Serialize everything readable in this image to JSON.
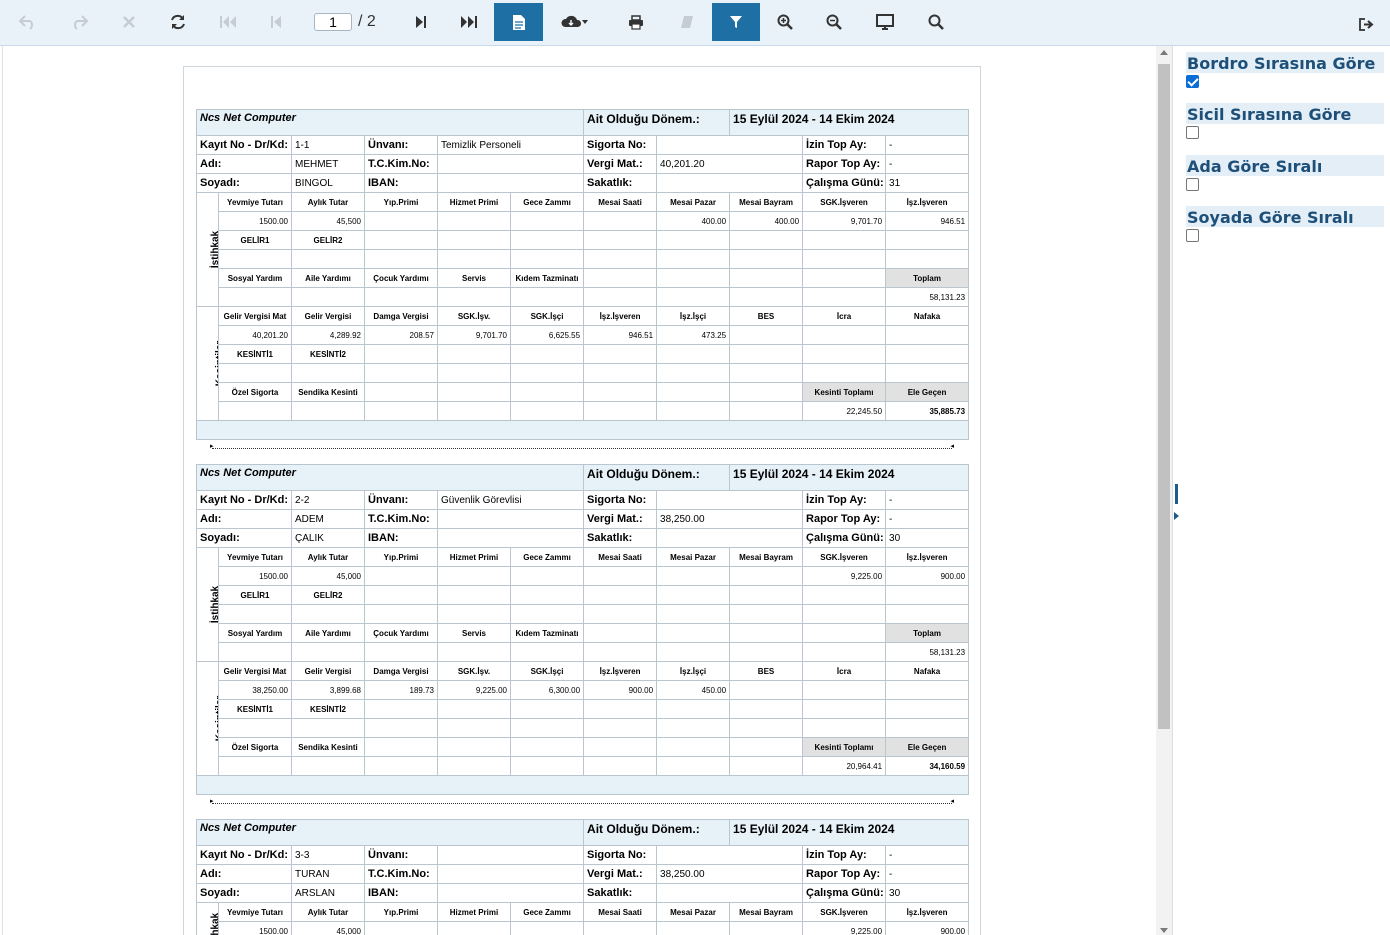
{
  "toolbar": {
    "page_current": "1",
    "page_total": "/ 2",
    "buttons": [
      "undo-icon",
      "redo-icon",
      "close-icon",
      "refresh-icon",
      "first-page-icon",
      "previous-page-icon",
      "next-page-icon",
      "last-page-icon",
      "document-icon",
      "download-icon",
      "print-icon",
      "edit-icon",
      "filter-icon",
      "zoom-in-icon",
      "zoom-out-icon",
      "fullscreen-icon",
      "search-icon",
      "exit-icon"
    ]
  },
  "sidebar": {
    "options": [
      {
        "label": "Bordro Sırasına Göre",
        "checked": true
      },
      {
        "label": "Sicil Sırasına Göre",
        "checked": false
      },
      {
        "label": "Ada Göre Sıralı",
        "checked": false
      },
      {
        "label": "Soyada Göre Sıralı",
        "checked": false
      }
    ]
  },
  "labels": {
    "company": "Ncs Net Computer",
    "period_label": "Ait Olduğu Dönem.:",
    "period": "15 Eylül 2024 - 14 Ekim 2024",
    "kayit": "Kayıt No - Dr/Kd:",
    "unvan": "Ünvanı:",
    "sigorta": "Sigorta No:",
    "izin": "İzin Top Ay:",
    "adi": "Adı:",
    "tc": "T.C.Kim.No:",
    "vergi": "Vergi Mat.:",
    "rapor": "Rapor Top Ay:",
    "soyadi": "Soyadı:",
    "iban": "IBAN:",
    "sakatlik": "Sakatlık:",
    "calisma": "Çalışma Günü:",
    "istihkak": "İstihkak",
    "kesintiler": "Kesintiler",
    "row1": [
      "Yevmiye Tutarı",
      "Aylık Tutar",
      "Yıp.Primi",
      "Hizmet Primi",
      "Gece Zammı",
      "Mesai Saati",
      "Mesai Pazar",
      "Mesai Bayram",
      "SGK.İşveren",
      "İşz.İşveren"
    ],
    "row2": [
      "GELİR1",
      "GELİR2"
    ],
    "row3": [
      "Sosyal Yardım",
      "Aile Yardımı",
      "Çocuk Yardımı",
      "Servis",
      "Kıdem Tazminatı",
      "Toplam"
    ],
    "row4": [
      "Gelir Vergisi Mat",
      "Gelir Vergisi",
      "Damga Vergisi",
      "SGK.İşv.",
      "SGK.İşçi",
      "İşz.İşveren",
      "İşz.İşçi",
      "BES",
      "İcra",
      "Nafaka"
    ],
    "row5": [
      "KESİNTİ1",
      "KESİNTİ2"
    ],
    "row6": [
      "Özel Sigorta",
      "Sendika Kesinti",
      "Kesinti Toplamı",
      "Ele Geçen"
    ]
  },
  "slips": [
    {
      "kayit_no": "1-1",
      "unvan": "Temizlik Personeli",
      "sigorta_no": "",
      "izin": "-",
      "adi": "MEHMET",
      "tc": "",
      "vergi_mat": "40,201.20",
      "rapor": "-",
      "soyadi": "BINGOL",
      "iban": "",
      "sakatlik": "",
      "calisma": "31",
      "earn": [
        "1500.00",
        "45,500",
        "",
        "",
        "",
        "",
        "400.00",
        "400.00",
        "9,701.70",
        "946.51"
      ],
      "toplam": "58,131.23",
      "ded": [
        "40,201.20",
        "4,289.92",
        "208.57",
        "9,701.70",
        "6,625.55",
        "946.51",
        "473.25",
        "",
        "",
        ""
      ],
      "kesinti_toplami": "22,245.50",
      "ele_gecen": "35,885.73"
    },
    {
      "kayit_no": "2-2",
      "unvan": "Güvenlik Görevlisi",
      "sigorta_no": "",
      "izin": "-",
      "adi": "ADEM",
      "tc": "",
      "vergi_mat": "38,250.00",
      "rapor": "-",
      "soyadi": "ÇALIK",
      "iban": "",
      "sakatlik": "",
      "calisma": "30",
      "earn": [
        "1500.00",
        "45,000",
        "",
        "",
        "",
        "",
        "",
        "",
        "9,225.00",
        "900.00"
      ],
      "toplam": "58,131.23",
      "ded": [
        "38,250.00",
        "3,899.68",
        "189.73",
        "9,225.00",
        "6,300.00",
        "900.00",
        "450.00",
        "",
        "",
        ""
      ],
      "kesinti_toplami": "20,964.41",
      "ele_gecen": "34,160.59"
    },
    {
      "kayit_no": "3-3",
      "unvan": "",
      "sigorta_no": "",
      "izin": "-",
      "adi": "TURAN",
      "tc": "",
      "vergi_mat": "38,250.00",
      "rapor": "-",
      "soyadi": "ARSLAN",
      "iban": "",
      "sakatlik": "",
      "calisma": "30",
      "earn": [
        "1500.00",
        "45,000",
        "",
        "",
        "",
        "",
        "",
        "",
        "9,225.00",
        "900.00"
      ]
    }
  ]
}
